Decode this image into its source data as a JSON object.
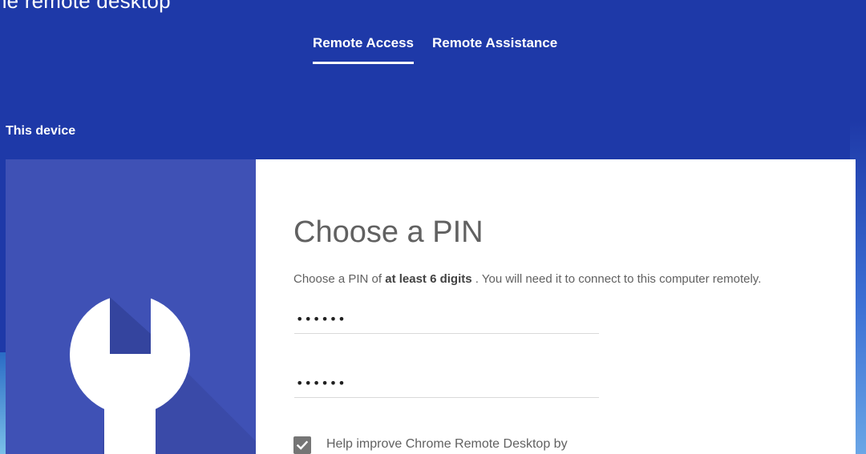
{
  "header": {
    "app_title": "ne remote desktop"
  },
  "tabs": [
    {
      "label": "Remote Access",
      "active": true
    },
    {
      "label": "Remote Assistance",
      "active": false
    }
  ],
  "section": {
    "label": "This device"
  },
  "dialog": {
    "icon": "wrench-icon",
    "title": "Choose a PIN",
    "description_prefix": "Choose a PIN of",
    "description_bold": "at least 6 digits",
    "description_suffix": ". You will need it to connect to this computer remotely.",
    "pin_value": "••••••",
    "pin_confirm_value": "••••••",
    "checkbox_checked": true,
    "checkbox_label": "Help improve Chrome Remote Desktop by"
  },
  "colors": {
    "header_bg": "#1e39a8",
    "card_left_bg": "#3f51b5",
    "card_right_bg": "#ffffff",
    "text_gray": "#616161"
  }
}
